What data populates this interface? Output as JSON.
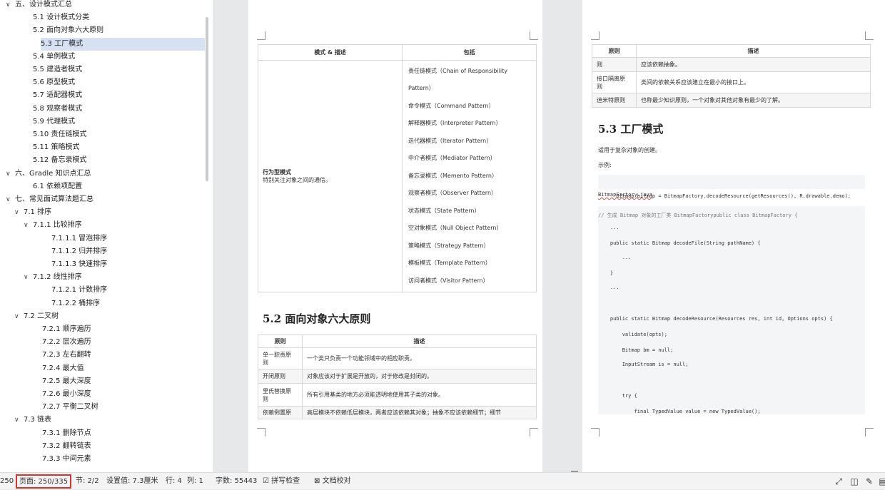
{
  "nav": {
    "items": [
      {
        "label": "五、设计模式汇总",
        "expanded": true
      },
      {
        "label": "5.1 设计模式分类"
      },
      {
        "label": "5.2 面向对象六大原则"
      },
      {
        "label": "5.3 工厂模式",
        "selected": true
      },
      {
        "label": "5.4 单例模式"
      },
      {
        "label": "5.5 建造者模式"
      },
      {
        "label": "5.6 原型模式"
      },
      {
        "label": "5.7 适配器模式"
      },
      {
        "label": "5.8 观察者模式"
      },
      {
        "label": "5.9 代理模式"
      },
      {
        "label": "5.10 责任链模式"
      },
      {
        "label": "5.11 策略模式"
      },
      {
        "label": "5.12 备忘录模式"
      },
      {
        "label": "六、Gradle 知识点汇总",
        "expanded": true
      },
      {
        "label": "6.1 依赖项配置"
      },
      {
        "label": "七、常见面试算法题汇总",
        "expanded": true
      },
      {
        "label": "7.1 排序",
        "expanded": true
      },
      {
        "label": "7.1.1 比较排序",
        "expanded": true
      },
      {
        "label": "7.1.1.1 冒泡排序"
      },
      {
        "label": "7.1.1.2 归并排序"
      },
      {
        "label": "7.1.1.3 快速排序"
      },
      {
        "label": "7.1.2 线性排序",
        "expanded": true
      },
      {
        "label": "7.1.2.1 计数排序"
      },
      {
        "label": "7.1.2.2 桶排序"
      },
      {
        "label": "7.2 二叉树",
        "expanded": true
      },
      {
        "label": "7.2.1 顺序遍历"
      },
      {
        "label": "7.2.2 层次遍历"
      },
      {
        "label": "7.2.3 左右翻转"
      },
      {
        "label": "7.2.4 最大值"
      },
      {
        "label": "7.2.5 最大深度"
      },
      {
        "label": "7.2.6 最小深度"
      },
      {
        "label": "7.2.7 平衡二叉树"
      },
      {
        "label": "7.3 链表",
        "expanded": true
      },
      {
        "label": "7.3.1 删除节点"
      },
      {
        "label": "7.3.2 翻转链表"
      },
      {
        "label": "7.3.3 中间元素"
      }
    ]
  },
  "left_page": {
    "pattern_table": {
      "headers": [
        "模式 & 描述",
        "包括"
      ],
      "category_title": "行为型模式",
      "category_desc": "特别关注对象之间的通信。",
      "patterns": [
        "责任链模式（Chain of Responsibility",
        "Pattern）",
        "命令模式（Command Pattern）",
        "解释器模式（Interpreter Pattern）",
        "迭代器模式（Iterator Pattern）",
        "中介者模式（Mediator Pattern）",
        "备忘录模式（Memento Pattern）",
        "观察者模式（Observer Pattern）",
        "状态模式（State Pattern）",
        "空对象模式（Null Object Pattern）",
        "策略模式（Strategy Pattern）",
        "模板模式（Template Pattern）",
        "访问者模式（Visitor Pattern）"
      ]
    },
    "heading": "5.2  面向对象六大原则",
    "principles_table": {
      "headers": [
        "原则",
        "描述"
      ],
      "rows": [
        {
          "name": "单一职责原\n则",
          "desc": "一个类只负责一个功能领域中的相应职责。"
        },
        {
          "name": "开闭原则",
          "desc": "对象应该对于扩展是开放的，对于修改是封闭的。"
        },
        {
          "name": "里氏替换原\n则",
          "desc": "所有引用基类的地方必须能透明地使用其子类的对象。"
        },
        {
          "name": "依赖倒置原",
          "desc": "高层模块不依赖低层模块，两者应该依赖其对象；抽象不应该依赖细节；细节"
        }
      ]
    }
  },
  "right_page": {
    "table": {
      "headers": [
        "原则",
        "描述"
      ],
      "rows": [
        {
          "name": "则",
          "desc": "应该依赖抽象。"
        },
        {
          "name": "接口隔离原\n则",
          "desc": "类间的依赖关系应该建立在最小的接口上。"
        },
        {
          "name": "迪米特原则",
          "desc": "也称最少知识原则，一个对象对其他对象有最少的了解。"
        }
      ]
    },
    "heading": "5.3  工厂模式",
    "intro": "适用于复杂对象的创建。",
    "example_label": "示例:",
    "code1": "Bitmap bitmap = BitmapFactory.decodeResource(getResources(), R.drawable.demo);",
    "filename": "BitmapFactory.java",
    "code2": [
      "// 生成 Bitmap 对象的工厂类 BitmapFactorypublic class BitmapFactory {",
      "    ...",
      "    public static Bitmap decodeFile(String pathName) {",
      "        ...",
      "    }",
      "    ...",
      "",
      "    public static Bitmap decodeResource(Resources res, int id, Options opts) {",
      "        validate(opts);",
      "        Bitmap bm = null;",
      "        InputStream is = null;",
      "",
      "        try {",
      "            final TypedValue value = new TypedValue();"
    ]
  },
  "status": {
    "page_prefix": "250",
    "page": "页面: 250/335",
    "section": "节: 2/2",
    "setting": "设置值: 7.3厘米",
    "row": "行: 4",
    "col": "列: 1",
    "words": "字数: 55443",
    "spell": "拼写检查",
    "proof": "文档校对"
  }
}
